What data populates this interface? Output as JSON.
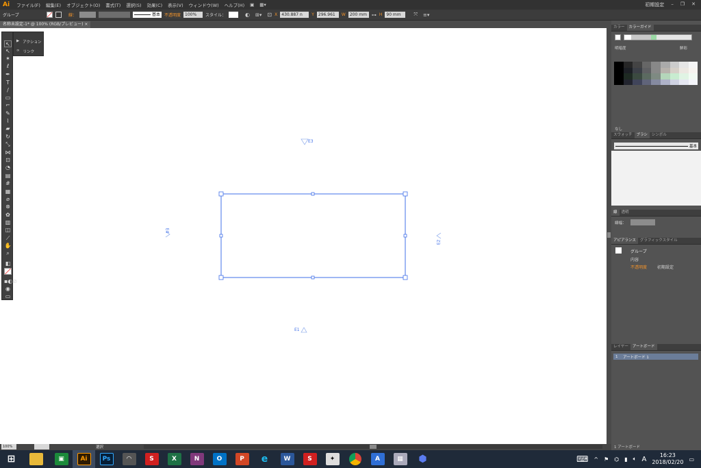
{
  "menubar": {
    "logo": "Ai",
    "items": [
      "ファイル(F)",
      "編集(E)",
      "オブジェクト(O)",
      "書式(T)",
      "選択(S)",
      "効果(C)",
      "表示(V)",
      "ウィンドウ(W)",
      "ヘルプ(H)"
    ],
    "workspace": "初期設定"
  },
  "control": {
    "selection_label": "グループ",
    "stroke_label": "線：",
    "stroke_style": "基本",
    "opacity_label": "不透明度",
    "opacity_value": "100%",
    "style_label": "スタイル：",
    "x_label": "X",
    "x_value": "430.887 n",
    "y_label": "Y",
    "y_value": "296.961 n",
    "w_label": "W",
    "w_value": "200 mm",
    "h_label": "H",
    "h_value": "90 mm"
  },
  "document": {
    "tab_title": "名称未設定-1* @ 100% (RGB/プレビュー)",
    "zoom": "100%",
    "status": "選択"
  },
  "canvas_labels": {
    "top": "E3",
    "bottom": "E1",
    "left": "E4",
    "right": "E2"
  },
  "action_panel": {
    "action_label": "アクション",
    "link_label": "リンク"
  },
  "panels": {
    "color_tabs": [
      "カラー",
      "カラーガイド"
    ],
    "color_mode_label": "明暗度",
    "color_mode_value": "鮮彩",
    "color_footer": "なし",
    "brush_tabs": [
      "スウォッチ",
      "ブラシ",
      "シンボル"
    ],
    "brush_name": "基本",
    "stroke_tabs": [
      "線",
      "透明"
    ],
    "stroke_weight_label": "線幅：",
    "appearance_tabs": [
      "アピアランス",
      "グラフィックスタイル"
    ],
    "appearance_group": "グループ",
    "appearance_contents": "内容",
    "appearance_opacity_label": "不透明度",
    "appearance_opacity_value": "初期設定",
    "layer_tabs": [
      "レイヤー",
      "アートボード"
    ],
    "artboard_index": "1",
    "artboard_name": "アートボード 1",
    "artboard_footer": "1 アートボード"
  },
  "taskbar": {
    "time": "16:23",
    "date": "2018/02/20",
    "ime": "A"
  },
  "colors": {
    "accent": "#3f6fe8",
    "app_orange": "#ff9a00"
  }
}
